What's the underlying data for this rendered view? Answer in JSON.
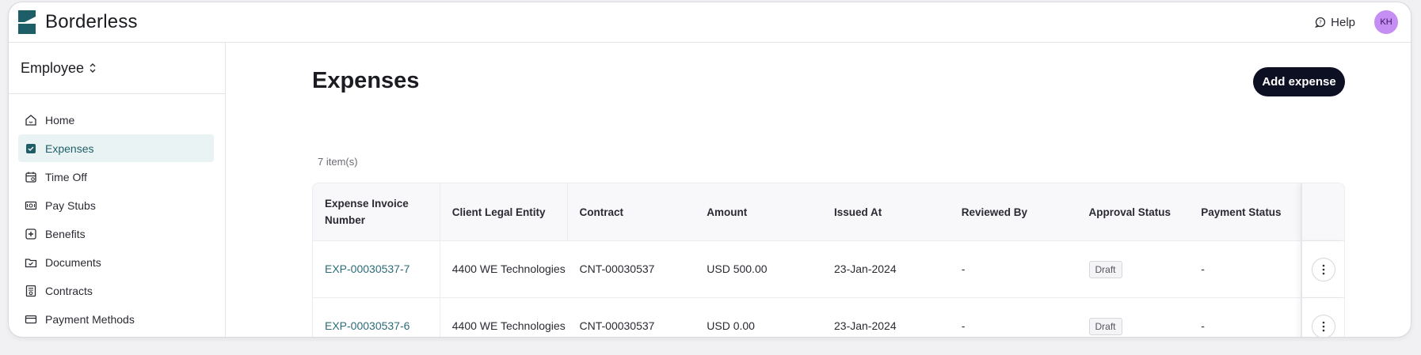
{
  "app": {
    "brand_name": "Borderless",
    "help_label": "Help",
    "avatar_initials": "KH",
    "accent_color": "#1e5f67",
    "avatar_color": "#c48ef3"
  },
  "sidebar": {
    "role_label": "Employee",
    "items": [
      {
        "label": "Home",
        "icon": "home-icon"
      },
      {
        "label": "Expenses",
        "icon": "expenses-icon",
        "active": true
      },
      {
        "label": "Time Off",
        "icon": "calendar-icon"
      },
      {
        "label": "Pay Stubs",
        "icon": "pay-stubs-icon"
      },
      {
        "label": "Benefits",
        "icon": "benefits-icon"
      },
      {
        "label": "Documents",
        "icon": "folder-icon"
      },
      {
        "label": "Contracts",
        "icon": "contract-icon"
      },
      {
        "label": "Payment Methods",
        "icon": "card-icon"
      }
    ]
  },
  "main": {
    "title": "Expenses",
    "add_button_label": "Add expense",
    "item_count": "7 item(s)",
    "table": {
      "columns": [
        "Expense Invoice Number",
        "Client Legal Entity",
        "Contract",
        "Amount",
        "Issued At",
        "Reviewed By",
        "Approval Status",
        "Payment Status"
      ],
      "rows": [
        {
          "invoice": "EXP-00030537-7",
          "entity": "4400 WE Technologies",
          "contract": "CNT-00030537",
          "amount": "USD 500.00",
          "issued_at": "23-Jan-2024",
          "reviewed_by": "-",
          "approval_status": "Draft",
          "payment_status": "-"
        },
        {
          "invoice": "EXP-00030537-6",
          "entity": "4400 WE Technologies",
          "contract": "CNT-00030537",
          "amount": "USD 0.00",
          "issued_at": "23-Jan-2024",
          "reviewed_by": "-",
          "approval_status": "Draft",
          "payment_status": "-"
        }
      ]
    }
  }
}
